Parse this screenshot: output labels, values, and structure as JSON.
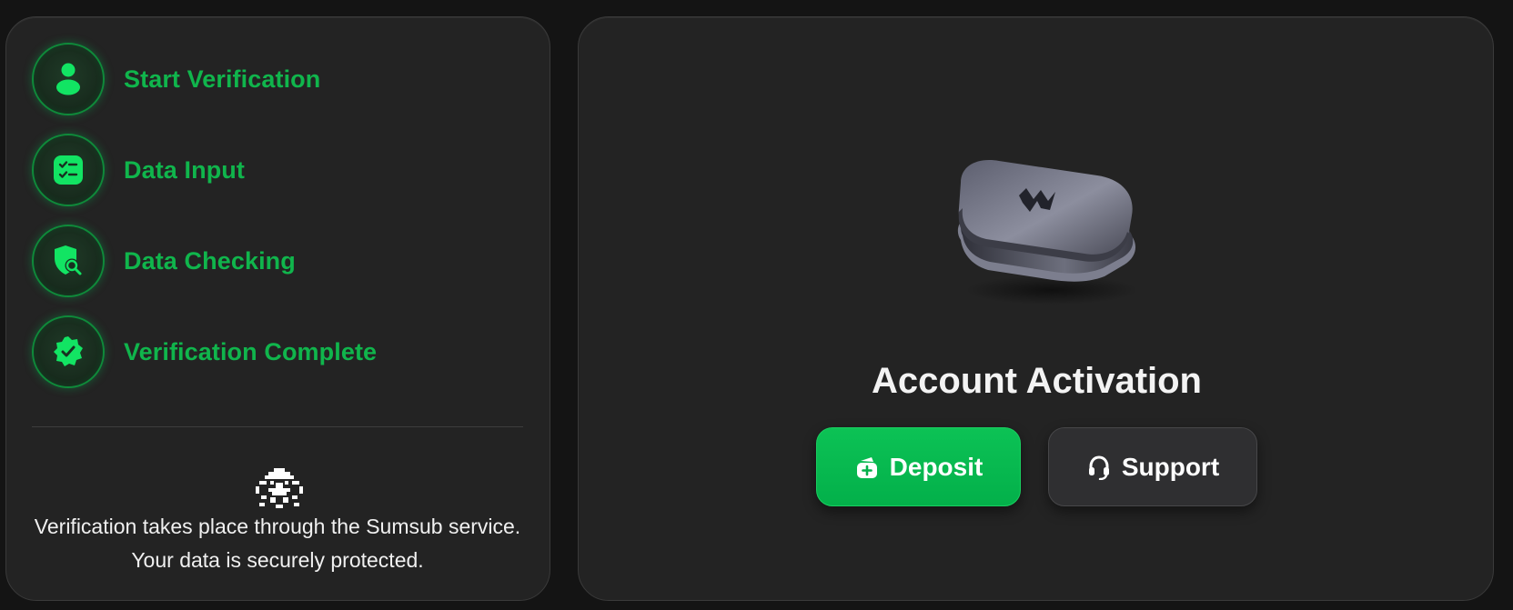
{
  "steps": [
    {
      "label": "Start Verification",
      "icon": "user-icon"
    },
    {
      "label": "Data Input",
      "icon": "checklist-icon"
    },
    {
      "label": "Data Checking",
      "icon": "shield-search-icon"
    },
    {
      "label": "Verification Complete",
      "icon": "verified-badge-icon"
    }
  ],
  "footer": {
    "logo_icon": "sumsub-logo-icon",
    "note": "Verification takes place through the Sumsub service. Your data is securely protected."
  },
  "activation": {
    "product_image": "hardware-wallet-image",
    "title": "Account Activation",
    "deposit_label": "Deposit",
    "deposit_icon": "wallet-add-icon",
    "support_label": "Support",
    "support_icon": "headset-icon"
  },
  "colors": {
    "accent_green": "#10b54c",
    "button_green": "#03b04a",
    "panel_bg": "#232323",
    "page_bg": "#141414"
  }
}
